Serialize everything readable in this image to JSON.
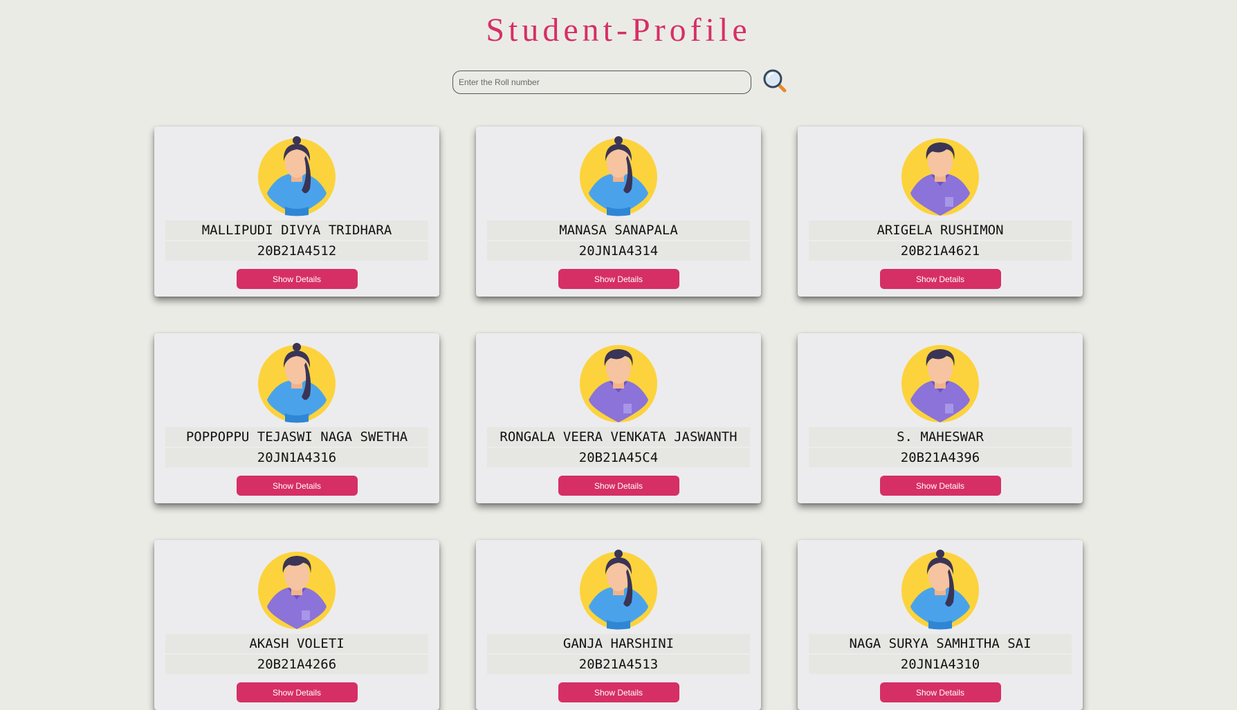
{
  "page": {
    "title": "Student-Profile",
    "accent_color": "#d62f66",
    "background_color": "#ebebe6"
  },
  "search": {
    "placeholder": "Enter the Roll number",
    "value": "",
    "icon": "search-icon"
  },
  "students": [
    {
      "name": "MALLIPUDI DIVYA TRIDHARA",
      "roll": "20B21A4512",
      "avatar": "female-avatar",
      "button_label": "Show Details"
    },
    {
      "name": "MANASA SANAPALA",
      "roll": "20JN1A4314",
      "avatar": "female-avatar",
      "button_label": "Show Details"
    },
    {
      "name": "ARIGELA RUSHIMON",
      "roll": "20B21A4621",
      "avatar": "male-avatar",
      "button_label": "Show Details"
    },
    {
      "name": "POPPOPPU TEJASWI NAGA SWETHA",
      "roll": "20JN1A4316",
      "avatar": "female-avatar",
      "button_label": "Show Details"
    },
    {
      "name": "RONGALA VEERA VENKATA JASWANTH",
      "roll": "20B21A45C4",
      "avatar": "male-avatar",
      "button_label": "Show Details"
    },
    {
      "name": "S. MAHESWAR",
      "roll": "20B21A4396",
      "avatar": "male-avatar",
      "button_label": "Show Details"
    },
    {
      "name": "AKASH VOLETI",
      "roll": "20B21A4266",
      "avatar": "male-avatar",
      "button_label": "Show Details"
    },
    {
      "name": "GANJA HARSHINI",
      "roll": "20B21A4513",
      "avatar": "female-avatar",
      "button_label": "Show Details"
    },
    {
      "name": "NAGA SURYA SAMHITHA SAI",
      "roll": "20JN1A4310",
      "avatar": "female-avatar",
      "button_label": "Show Details"
    }
  ]
}
